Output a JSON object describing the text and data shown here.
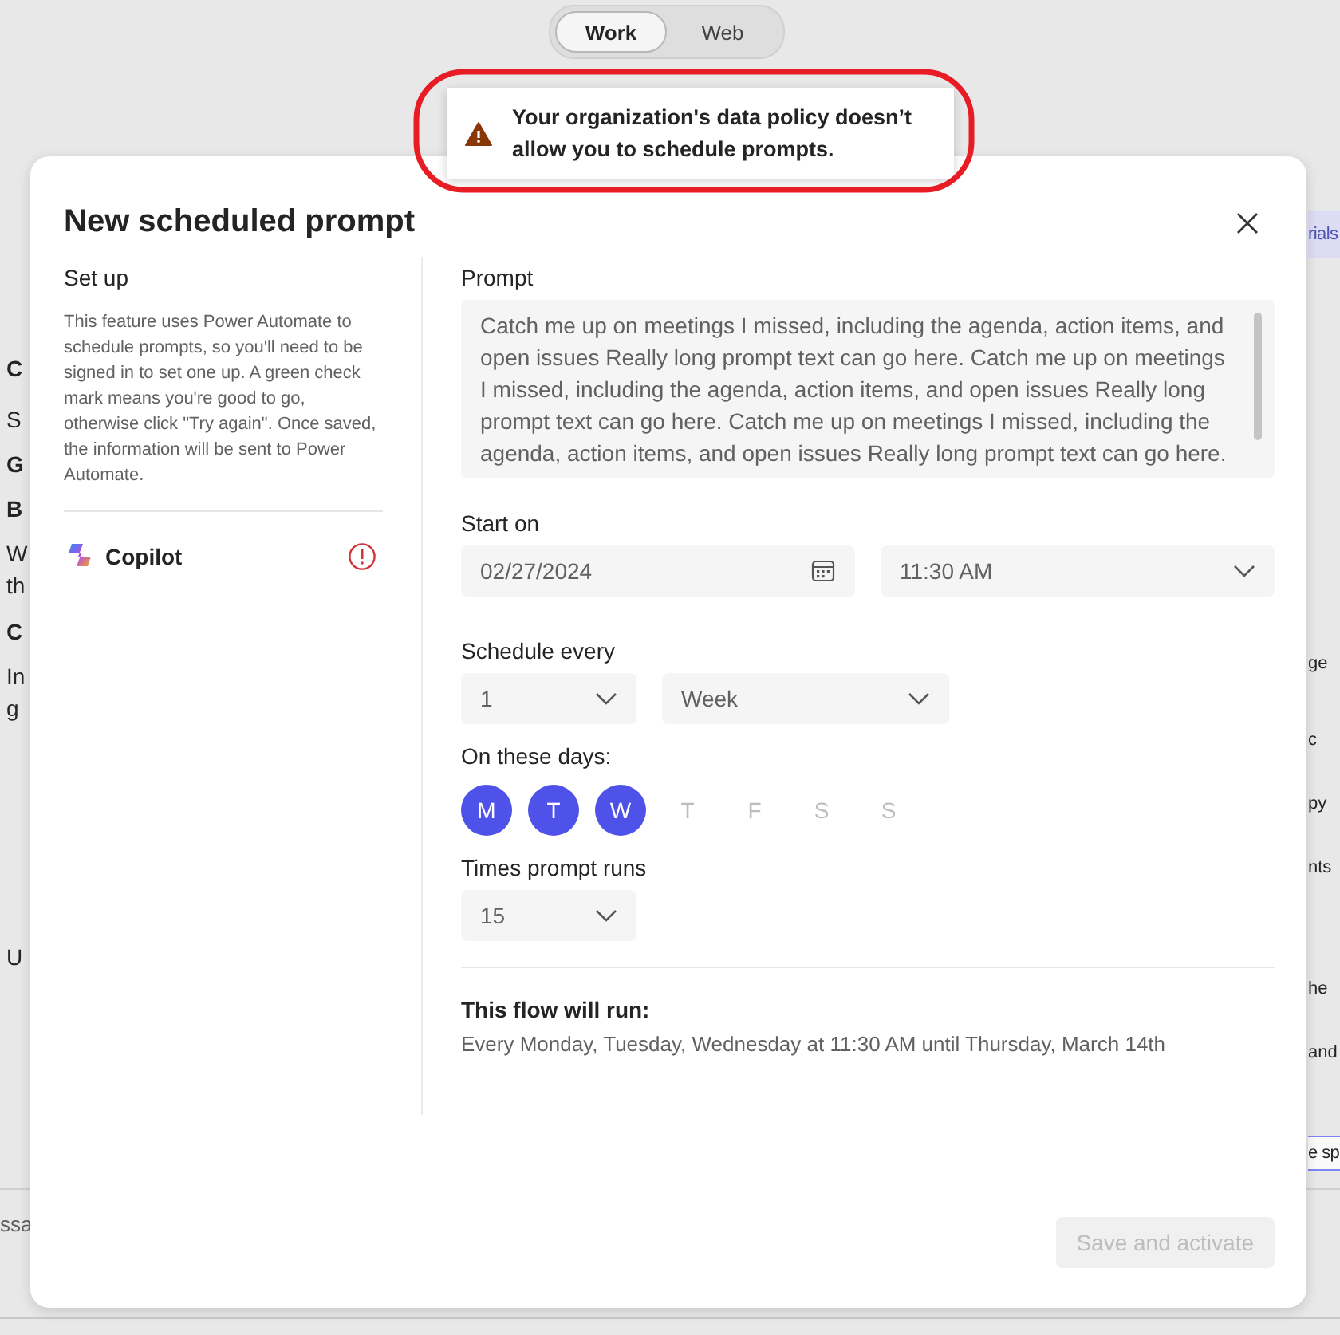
{
  "view_toggle": [
    {
      "label": "Work",
      "selected": true
    },
    {
      "label": "Web",
      "selected": false
    }
  ],
  "background": {
    "left_fragments": [
      "C",
      "S",
      "G",
      "B",
      "W",
      "th",
      "C",
      "In",
      "g",
      "U"
    ],
    "right_tab": "rials",
    "right_fragments": [
      "ge",
      "c",
      "py",
      "nts",
      "he",
      "and"
    ],
    "input_fragment": "e sp",
    "message_fragment": "ssa"
  },
  "toast": {
    "message": "Your organization's data policy doesn’t allow you to schedule prompts."
  },
  "dialog": {
    "title": "New scheduled prompt",
    "setup": {
      "heading": "Set up",
      "description": "This feature uses Power Automate to schedule prompts, so you'll need to be signed in to set one up. A green check mark means you're good to go, otherwise click \"Try again\".  Once saved, the information will be sent to Power Automate.",
      "account": {
        "name": "Copilot",
        "error": true
      }
    },
    "prompt": {
      "label": "Prompt",
      "value": "Catch me up on meetings I missed, including the agenda, action items, and open issues Really long prompt text can go here. Catch me up on meetings I missed, including the agenda, action items, and open issues Really long prompt text can go here. Catch me up on meetings I missed, including the agenda, action items, and open issues Really long prompt text can go here."
    },
    "start_on": {
      "label": "Start on",
      "date": "02/27/2024",
      "time": "11:30 AM"
    },
    "schedule_every": {
      "label": "Schedule every",
      "count": "1",
      "unit": "Week"
    },
    "days": {
      "label": "On these days:",
      "items": [
        {
          "label": "M",
          "selected": true
        },
        {
          "label": "T",
          "selected": true
        },
        {
          "label": "W",
          "selected": true
        },
        {
          "label": "T",
          "selected": false
        },
        {
          "label": "F",
          "selected": false
        },
        {
          "label": "S",
          "selected": false
        },
        {
          "label": "S",
          "selected": false
        }
      ]
    },
    "times": {
      "label": "Times prompt runs",
      "value": "15"
    },
    "summary": {
      "heading": "This flow will run:",
      "text": "Every Monday, Tuesday, Wednesday at 11:30 AM until Thursday, March 14th"
    },
    "save_button": {
      "label": "Save and activate",
      "disabled": true
    }
  }
}
